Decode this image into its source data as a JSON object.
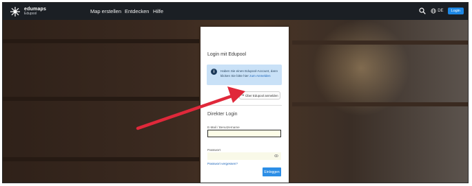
{
  "brand": {
    "name": "edumaps",
    "sub": "Edupool"
  },
  "nav": {
    "items": [
      "Map erstellen",
      "Entdecken",
      "Hilfe"
    ],
    "lang": "DE",
    "login": "Login"
  },
  "panel": {
    "title": "Login mit Edupool",
    "info_text": "Haben Sie einen Edupool-Account, dann klicken Sie bitte hier ",
    "info_link": "zum Anmelden",
    "edupool_button": "Über Edupool anmelden",
    "direct_title": "Direkter Login",
    "email_label": "E-Mail / Benutzername",
    "email_value": "",
    "password_label": "Passwort",
    "password_value": "",
    "forgot": "Passwort vergessen?",
    "submit": "Einloggen"
  },
  "colors": {
    "accent": "#1e88e5",
    "arrow": "#e0283a",
    "info_bg": "#c9e1f7"
  }
}
